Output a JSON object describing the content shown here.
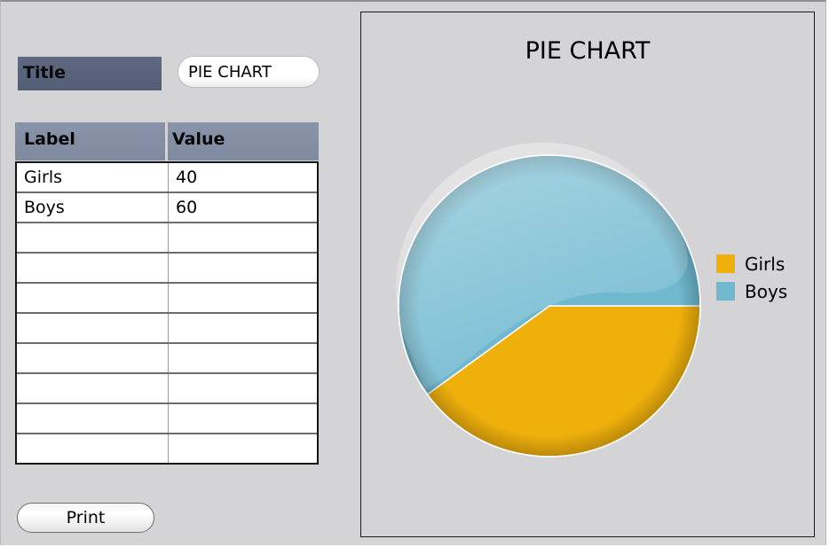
{
  "form": {
    "title_label": "Title",
    "title_value": "PIE CHART"
  },
  "table": {
    "headers": [
      "Label",
      "Value"
    ],
    "rows": [
      [
        "Girls",
        "40"
      ],
      [
        "Boys",
        "60"
      ],
      [
        "",
        ""
      ],
      [
        "",
        ""
      ],
      [
        "",
        ""
      ],
      [
        "",
        ""
      ],
      [
        "",
        ""
      ],
      [
        "",
        ""
      ],
      [
        "",
        ""
      ],
      [
        "",
        ""
      ]
    ]
  },
  "print_button": {
    "label": "Print"
  },
  "chart_data": {
    "type": "pie",
    "title": "PIE CHART",
    "categories": [
      "Girls",
      "Boys"
    ],
    "values": [
      40,
      60
    ],
    "colors": [
      "#f0b00c",
      "#6fb8cf"
    ],
    "legend_position": "right"
  }
}
